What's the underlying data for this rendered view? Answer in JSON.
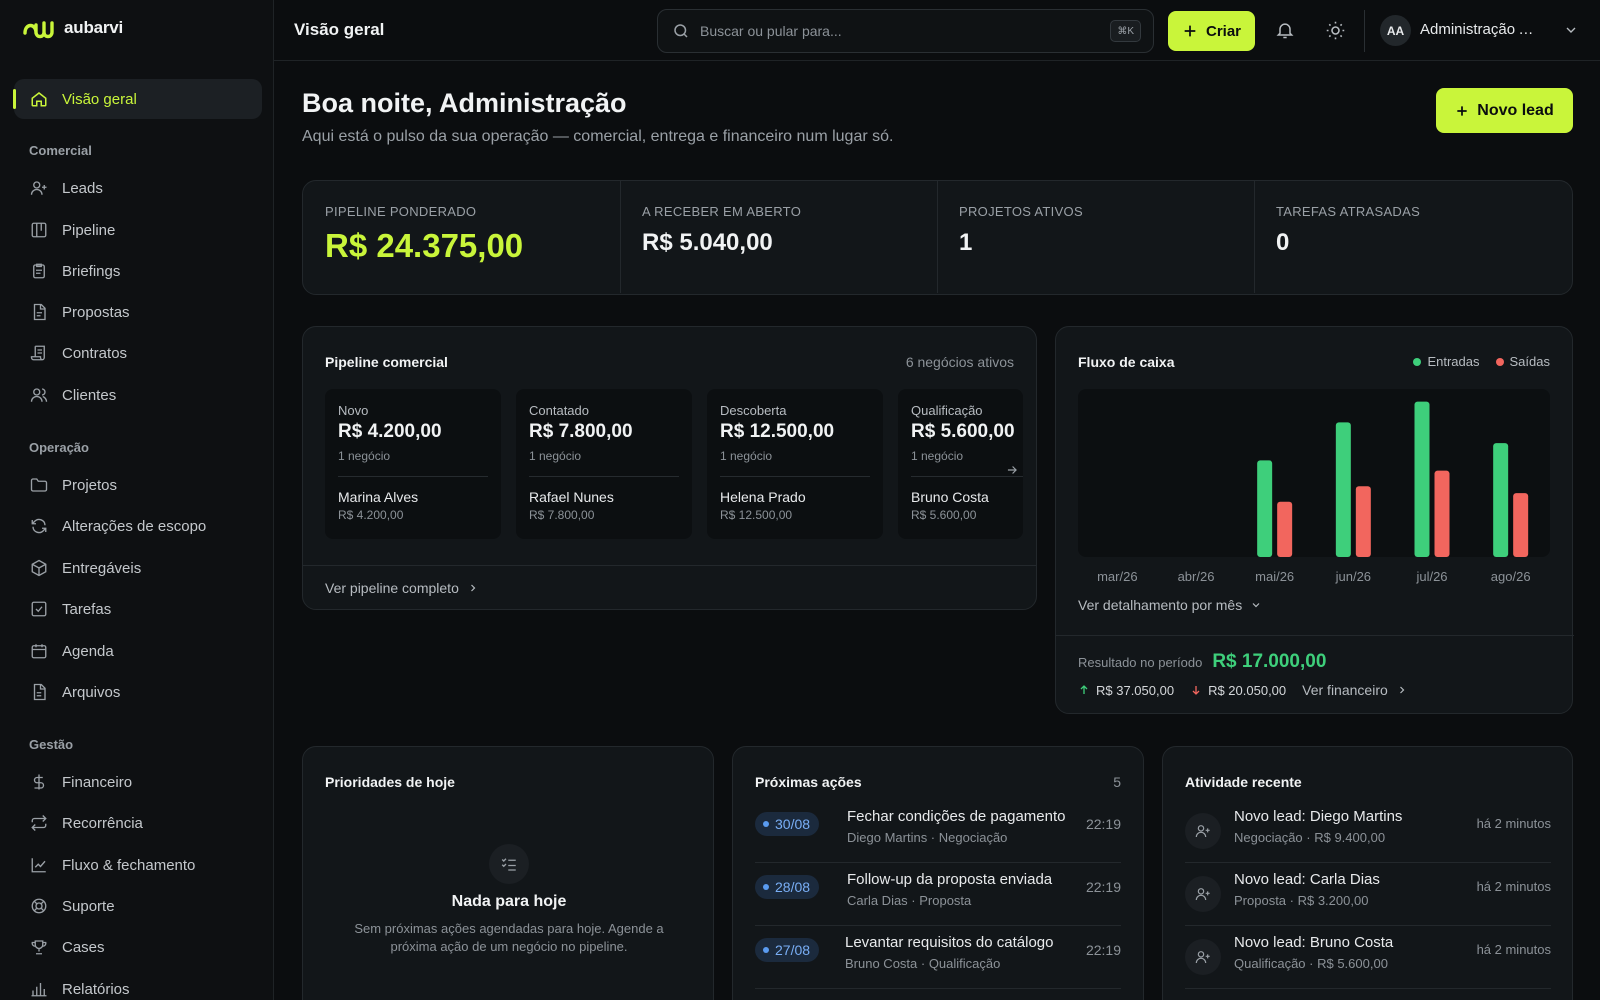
{
  "app": {
    "name": "aubarvi"
  },
  "colors": {
    "accent": "#c9f53a",
    "entradas": "#3ecf7b",
    "saidas": "#f2665e",
    "date_blue": "#79aef5"
  },
  "sidebar": {
    "active": {
      "label": "Visão geral",
      "icon": "home-icon"
    },
    "sections": [
      {
        "title": "Comercial",
        "items": [
          {
            "label": "Leads",
            "icon": "user-plus-icon"
          },
          {
            "label": "Pipeline",
            "icon": "kanban-icon"
          },
          {
            "label": "Briefings",
            "icon": "clipboard-icon"
          },
          {
            "label": "Propostas",
            "icon": "document-icon"
          },
          {
            "label": "Contratos",
            "icon": "scroll-icon"
          },
          {
            "label": "Clientes",
            "icon": "users-icon"
          }
        ]
      },
      {
        "title": "Operação",
        "items": [
          {
            "label": "Projetos",
            "icon": "folder-icon"
          },
          {
            "label": "Alterações de escopo",
            "icon": "refresh-icon"
          },
          {
            "label": "Entregáveis",
            "icon": "package-icon"
          },
          {
            "label": "Tarefas",
            "icon": "checkbox-icon"
          },
          {
            "label": "Agenda",
            "icon": "calendar-icon"
          },
          {
            "label": "Arquivos",
            "icon": "file-icon"
          }
        ]
      },
      {
        "title": "Gestão",
        "items": [
          {
            "label": "Financeiro",
            "icon": "dollar-icon"
          },
          {
            "label": "Recorrência",
            "icon": "repeat-icon"
          },
          {
            "label": "Fluxo & fechamento",
            "icon": "trend-icon"
          },
          {
            "label": "Suporte",
            "icon": "lifebuoy-icon"
          },
          {
            "label": "Cases",
            "icon": "trophy-icon"
          },
          {
            "label": "Relatórios",
            "icon": "bar-chart-icon"
          }
        ]
      }
    ]
  },
  "topbar": {
    "title": "Visão geral",
    "search_placeholder": "Buscar ou pular para...",
    "search_shortcut": "⌘K",
    "create_label": "Criar",
    "user_initials": "AA",
    "user_name": "Administração Aubarvi"
  },
  "header": {
    "greeting": "Boa noite, Administração",
    "subtitle": "Aqui está o pulso da sua operação — comercial, entrega e financeiro num lugar só.",
    "new_lead_label": "Novo lead"
  },
  "kpis": [
    {
      "label": "PIPELINE PONDERADO",
      "value": "R$ 24.375,00"
    },
    {
      "label": "A RECEBER EM ABERTO",
      "value": "R$ 5.040,00"
    },
    {
      "label": "PROJETOS ATIVOS",
      "value": "1"
    },
    {
      "label": "TAREFAS ATRASADAS",
      "value": "0"
    }
  ],
  "pipeline": {
    "title": "Pipeline comercial",
    "count_label": "6 negócios ativos",
    "footer_link": "Ver pipeline completo",
    "stages": [
      {
        "name": "Novo",
        "value": "R$ 4.200,00",
        "count": "1 negócio",
        "person": "Marina Alves",
        "person_value": "R$ 4.200,00"
      },
      {
        "name": "Contatado",
        "value": "R$ 7.800,00",
        "count": "1 negócio",
        "person": "Rafael Nunes",
        "person_value": "R$ 7.800,00"
      },
      {
        "name": "Descoberta",
        "value": "R$ 12.500,00",
        "count": "1 negócio",
        "person": "Helena Prado",
        "person_value": "R$ 12.500,00"
      },
      {
        "name": "Qualificação",
        "value": "R$ 5.600,00",
        "count": "1 negócio",
        "person": "Bruno Costa",
        "person_value": "R$ 5.600,00"
      }
    ]
  },
  "cashflow": {
    "title": "Fluxo de caixa",
    "legend_in": "Entradas",
    "legend_out": "Saídas",
    "detail_link": "Ver detalhamento por mês",
    "result_label": "Resultado no período",
    "result_value": "R$ 17.000,00",
    "total_in": "R$ 37.050,00",
    "total_out": "R$ 20.050,00",
    "finance_link": "Ver financeiro"
  },
  "chart_data": {
    "type": "bar",
    "categories": [
      "mar/26",
      "abr/26",
      "mai/26",
      "jun/26",
      "jul/26",
      "ago/26"
    ],
    "series": [
      {
        "name": "Entradas",
        "values": [
          0,
          0,
          5600,
          7800,
          9000,
          6600
        ]
      },
      {
        "name": "Saídas",
        "values": [
          0,
          0,
          3200,
          4100,
          5000,
          3700
        ]
      }
    ],
    "ylim": [
      0,
      9500
    ],
    "grid": false,
    "legend": "top-right"
  },
  "priorities": {
    "title": "Prioridades de hoje",
    "empty_title": "Nada para hoje",
    "empty_text": "Sem próximas ações agendadas para hoje. Agende a próxima ação de um negócio no pipeline."
  },
  "next_actions": {
    "title": "Próximas ações",
    "count": "5",
    "items": [
      {
        "date": "30/08",
        "title": "Fechar condições de pagamento",
        "meta": "Diego Martins · Negociação",
        "time": "22:19"
      },
      {
        "date": "28/08",
        "title": "Follow-up da proposta enviada",
        "meta": "Carla Dias · Proposta",
        "time": "22:19"
      },
      {
        "date": "27/08",
        "title": "Levantar requisitos do catálogo",
        "meta": "Bruno Costa · Qualificação",
        "time": "22:19"
      }
    ]
  },
  "activity": {
    "title": "Atividade recente",
    "items": [
      {
        "title": "Novo lead: Diego Martins",
        "meta": "Negociação · R$ 9.400,00",
        "time": "há 2 minutos"
      },
      {
        "title": "Novo lead: Carla Dias",
        "meta": "Proposta · R$ 3.200,00",
        "time": "há 2 minutos"
      },
      {
        "title": "Novo lead: Bruno Costa",
        "meta": "Qualificação · R$ 5.600,00",
        "time": "há 2 minutos"
      }
    ]
  }
}
